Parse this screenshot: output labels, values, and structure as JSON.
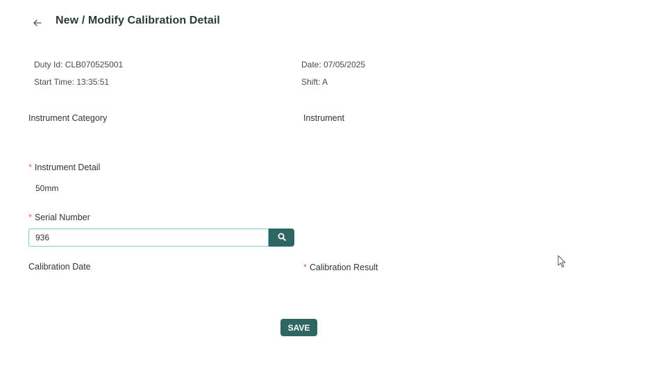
{
  "header": {
    "title": "New / Modify Calibration Detail"
  },
  "info": {
    "duty_id_label": "Duty Id:",
    "duty_id_value": "CLB070525001",
    "date_label": "Date:",
    "date_value": "07/05/2025",
    "start_time_label": "Start Time:",
    "start_time_value": "13:35:51",
    "shift_label": "Shift:",
    "shift_value": "A"
  },
  "form": {
    "instrument_category_label": "Instrument Category",
    "instrument_label": "Instrument",
    "instrument_detail_label": "Instrument Detail",
    "instrument_detail_value": "50mm",
    "serial_number_label": "Serial Number",
    "serial_number_value": "936",
    "calibration_date_label": "Calibration Date",
    "calibration_result_label": "Calibration Result",
    "required_marker": "*"
  },
  "actions": {
    "save_label": "SAVE"
  },
  "icons": {
    "back": "arrow-left-icon",
    "search": "search-icon",
    "cursor": "mouse-pointer-icon"
  },
  "colors": {
    "primary": "#2f6663",
    "input_border": "#7fc9d4",
    "required": "#e35d5d",
    "title": "#2b3b34"
  }
}
